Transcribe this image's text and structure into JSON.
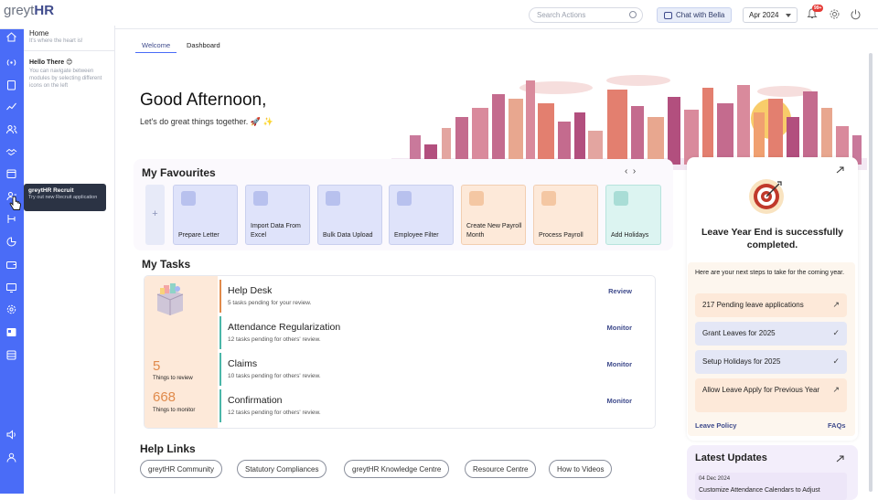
{
  "header": {
    "logo_grey": "greyt",
    "logo_hr": "HR",
    "search_placeholder": "Search Actions",
    "chat_label": "Chat with Bella",
    "month": "Apr 2024",
    "notifications_badge": "99+"
  },
  "sidebar": {
    "home_title": "Home",
    "home_tagline": "It's where the heart is!",
    "hello": "Hello There 😊",
    "hint": "You can navigate between modules by selecting different icons on the left"
  },
  "tooltip": {
    "title": "greytHR Recruit",
    "text": "Try out new Recruit application"
  },
  "tabs": [
    {
      "label": "Welcome",
      "active": true
    },
    {
      "label": "Dashboard",
      "active": false
    }
  ],
  "greeting": {
    "title": "Good Afternoon,",
    "subtitle": "Let's do great things together. 🚀 ✨"
  },
  "favourites": {
    "title": "My Favourites",
    "add": "+",
    "items": [
      {
        "label": "Prepare Letter",
        "color": "blue",
        "icon": "user-icon"
      },
      {
        "label": "Import Data From Excel",
        "color": "blue",
        "icon": "user-icon"
      },
      {
        "label": "Bulk Data Upload",
        "color": "blue",
        "icon": "user-icon"
      },
      {
        "label": "Employee Filter",
        "color": "blue",
        "icon": "user-icon"
      },
      {
        "label": "Create New Payroll Month",
        "color": "peach",
        "icon": "database-icon"
      },
      {
        "label": "Process Payroll",
        "color": "peach",
        "icon": "database-icon"
      },
      {
        "label": "Add Holidays",
        "color": "teal",
        "icon": "calendar-icon"
      }
    ]
  },
  "tasks": {
    "title": "My Tasks",
    "to_review_count": "5",
    "to_review_label": "Things to review",
    "to_monitor_count": "668",
    "to_monitor_label": "Things to monitor",
    "items": [
      {
        "name": "Help Desk",
        "desc": "5 tasks pending for your review.",
        "action": "Review",
        "bar": "#e08a4b"
      },
      {
        "name": "Attendance Regularization",
        "desc": "12 tasks pending for others' review.",
        "action": "Monitor",
        "bar": "#4bb6a8"
      },
      {
        "name": "Claims",
        "desc": "10 tasks pending for others' review.",
        "action": "Monitor",
        "bar": "#4bb6a8"
      },
      {
        "name": "Confirmation",
        "desc": "12 tasks pending for others' review.",
        "action": "Monitor",
        "bar": "#4bb6a8"
      }
    ]
  },
  "help_links": {
    "title": "Help Links",
    "items": [
      "greytHR Community",
      "Statutory Compliances",
      "greytHR Knowledge Centre",
      "Resource Centre",
      "How to Videos"
    ]
  },
  "leave_card": {
    "title": "Leave Year End is successfully completed.",
    "steps_header": "Here are your next steps to take for the coming year.",
    "steps": [
      {
        "label": "217 Pending leave applications",
        "state": "arrow",
        "color": "peach"
      },
      {
        "label": "Grant Leaves for 2025",
        "state": "done",
        "color": "blue"
      },
      {
        "label": "Setup Holidays for 2025",
        "state": "done",
        "color": "blue"
      },
      {
        "label": "Allow Leave Apply for Previous Year",
        "state": "arrow",
        "color": "peach"
      }
    ],
    "leave_policy": "Leave Policy",
    "faqs": "FAQs"
  },
  "updates": {
    "title": "Latest Updates",
    "date": "04 Dec 2024",
    "text": "Customize Attendance Calendars to Adjust"
  },
  "colors": {
    "rail": "#4a6cf7",
    "accent": "#3f4b8c",
    "orange": "#e08a4b",
    "teal": "#4bb6a8"
  }
}
